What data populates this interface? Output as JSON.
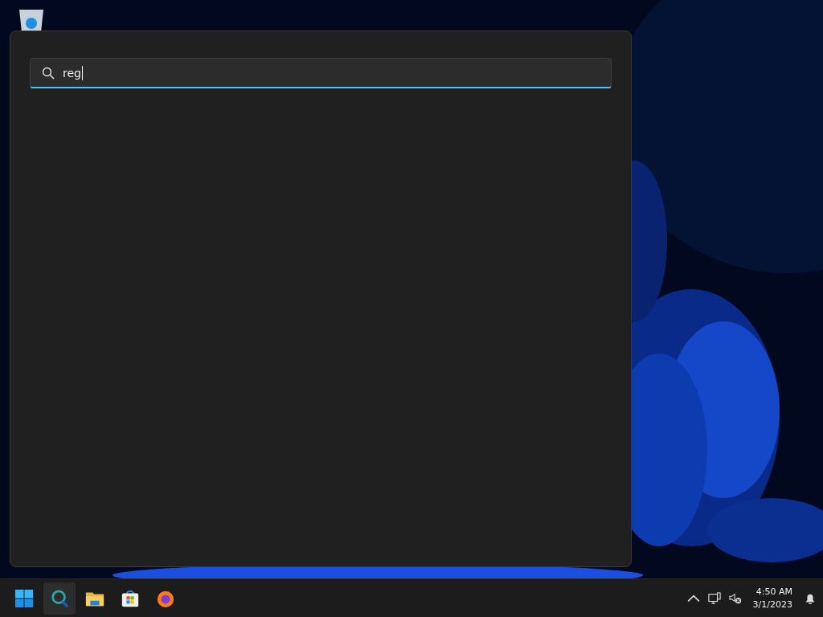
{
  "search_panel": {
    "search": {
      "value": "reg",
      "focused": true
    }
  },
  "taskbar": {
    "apps": [
      {
        "kind": "start",
        "selected": false
      },
      {
        "kind": "search",
        "selected": true
      },
      {
        "kind": "folder",
        "selected": false
      },
      {
        "kind": "store",
        "selected": false
      },
      {
        "kind": "browser",
        "selected": false
      }
    ],
    "tray": {
      "time": "4:50 AM",
      "date": "3/1/2023"
    }
  }
}
